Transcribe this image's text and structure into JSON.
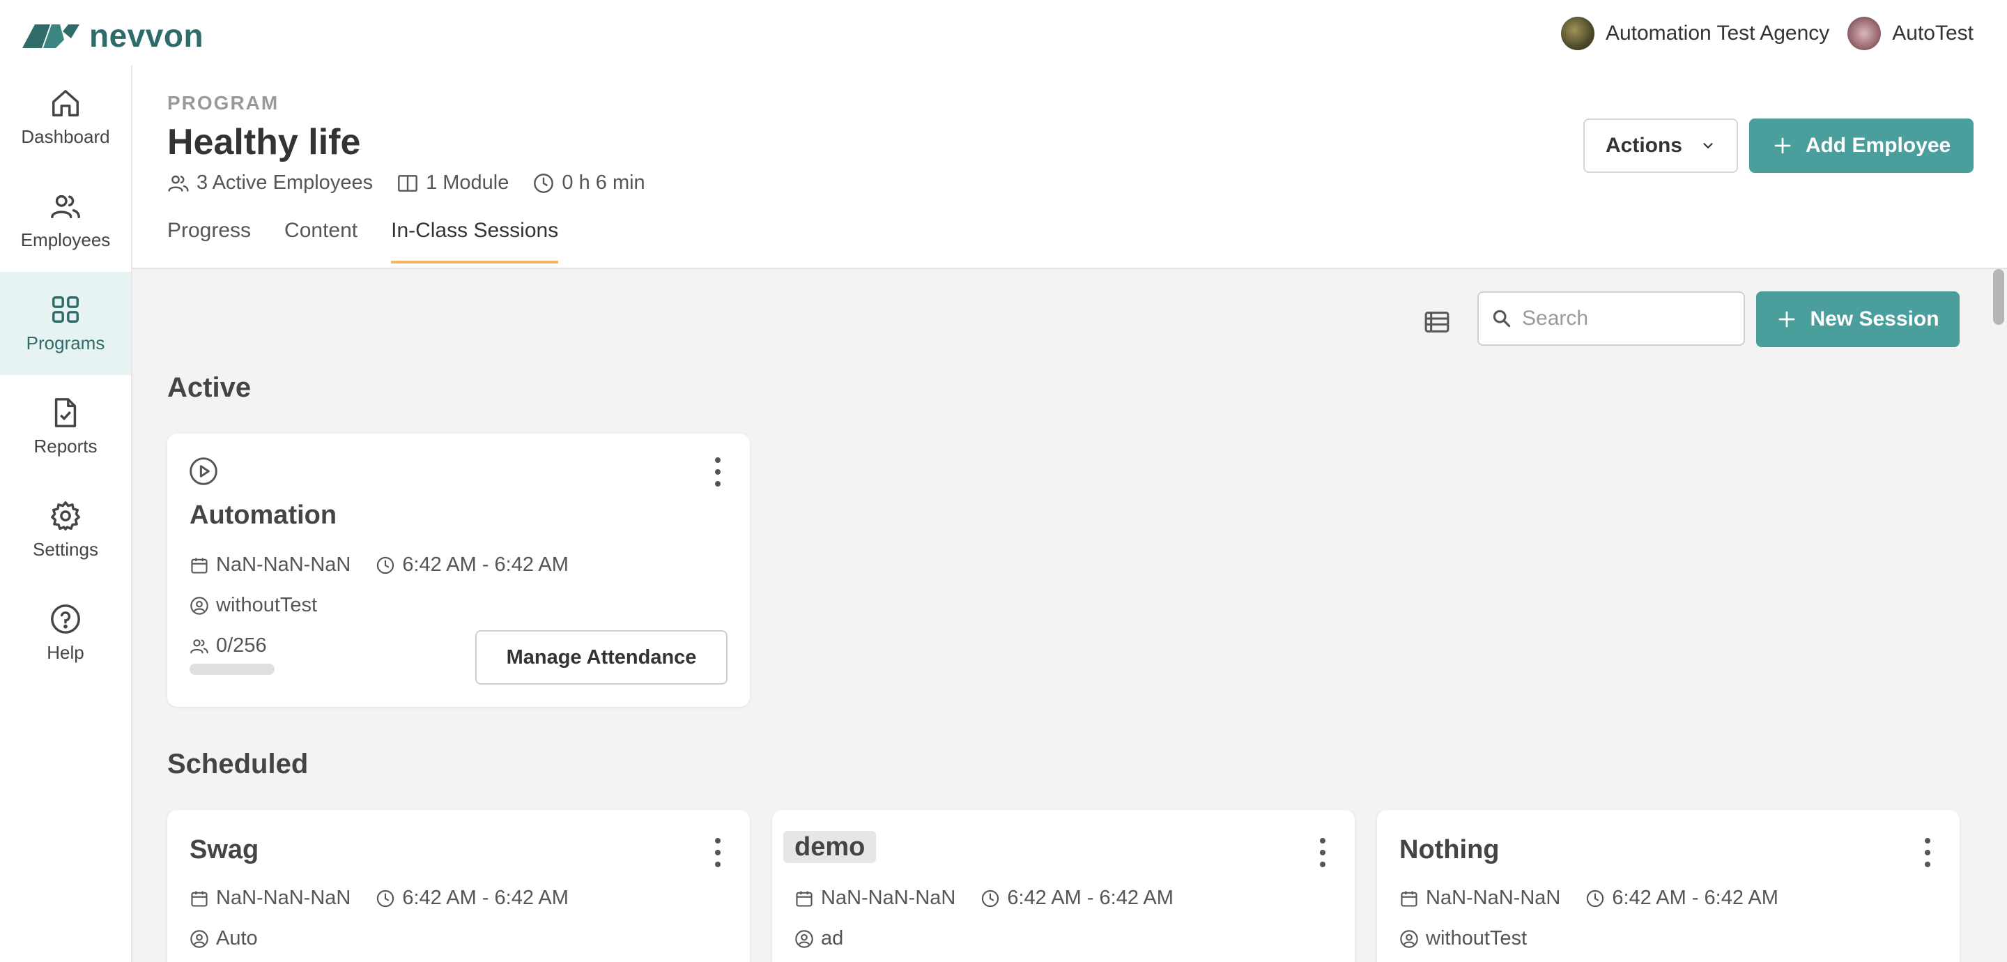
{
  "brand": {
    "name": "nevvon"
  },
  "topbar": {
    "agency": "Automation Test Agency",
    "user": "AutoTest"
  },
  "sidebar": {
    "items": [
      {
        "label": "Dashboard",
        "icon": "home-icon",
        "active": false
      },
      {
        "label": "Employees",
        "icon": "users-icon",
        "active": false
      },
      {
        "label": "Programs",
        "icon": "grid-icon",
        "active": true
      },
      {
        "label": "Reports",
        "icon": "report-icon",
        "active": false
      },
      {
        "label": "Settings",
        "icon": "gear-icon",
        "active": false
      },
      {
        "label": "Help",
        "icon": "help-icon",
        "active": false
      }
    ]
  },
  "header": {
    "label": "PROGRAM",
    "title": "Healthy life",
    "meta": {
      "employees": "3 Active Employees",
      "modules": "1 Module",
      "duration": "0 h 6 min"
    },
    "actions_label": "Actions",
    "add_employee_label": "Add Employee",
    "tabs": [
      {
        "label": "Progress",
        "active": false
      },
      {
        "label": "Content",
        "active": false
      },
      {
        "label": "In-Class Sessions",
        "active": true
      }
    ]
  },
  "toolbar": {
    "search_placeholder": "Search",
    "new_session_label": "New Session"
  },
  "sections": {
    "active": {
      "title": "Active",
      "sessions": [
        {
          "title": "Automation",
          "date": "NaN-NaN-NaN",
          "time": "6:42 AM - 6:42 AM",
          "instructor": "withoutTest",
          "attendance": "0/256",
          "attendance_fraction": 0,
          "manage_label": "Manage Attendance"
        }
      ]
    },
    "scheduled": {
      "title": "Scheduled",
      "sessions": [
        {
          "title": "Swag",
          "date": "NaN-NaN-NaN",
          "time": "6:42 AM - 6:42 AM",
          "instructor": "Auto"
        },
        {
          "title": "demo",
          "date": "NaN-NaN-NaN",
          "time": "6:42 AM - 6:42 AM",
          "instructor": "ad"
        },
        {
          "title": "Nothing",
          "date": "NaN-NaN-NaN",
          "time": "6:42 AM - 6:42 AM",
          "instructor": "withoutTest"
        }
      ]
    }
  },
  "colors": {
    "accent": "#4a9e9b",
    "tab_underline": "#f2b860",
    "brand": "#2f6b68"
  }
}
